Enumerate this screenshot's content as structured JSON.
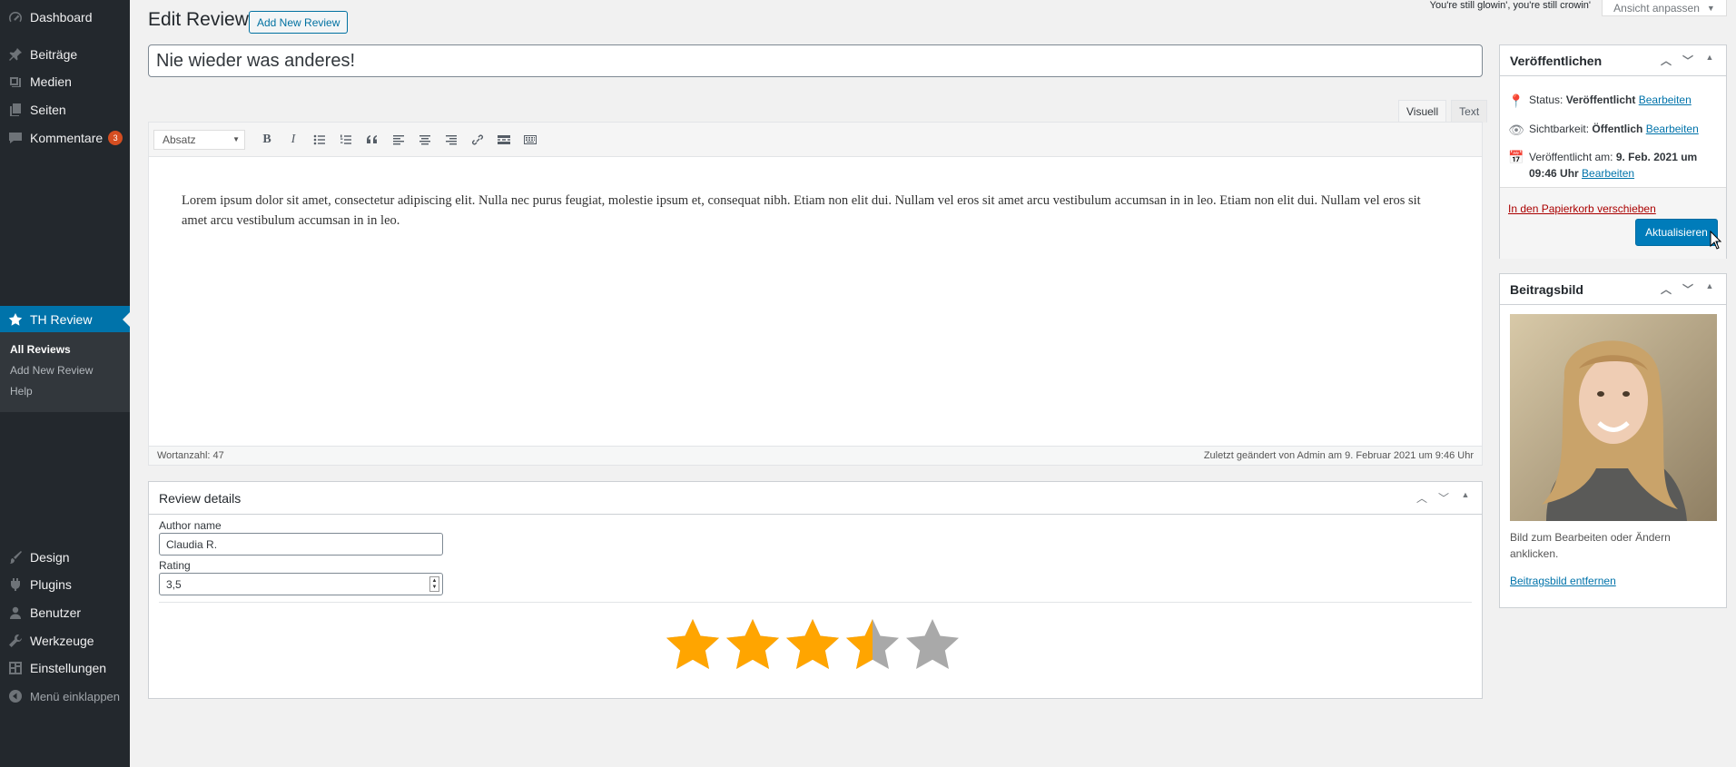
{
  "sidebar": {
    "items": [
      {
        "label": "Dashboard",
        "icon": "dashboard-icon"
      },
      {
        "label": "Beiträge",
        "icon": "pin-icon"
      },
      {
        "label": "Medien",
        "icon": "media-icon"
      },
      {
        "label": "Seiten",
        "icon": "pages-icon"
      },
      {
        "label": "Kommentare",
        "icon": "comments-icon",
        "badge": "3"
      },
      {
        "label": "TH Review",
        "icon": "star-icon"
      },
      {
        "label": "Design",
        "icon": "brush-icon"
      },
      {
        "label": "Plugins",
        "icon": "plugin-icon"
      },
      {
        "label": "Benutzer",
        "icon": "user-icon"
      },
      {
        "label": "Werkzeuge",
        "icon": "wrench-icon"
      },
      {
        "label": "Einstellungen",
        "icon": "settings-icon"
      },
      {
        "label": "Menü einklappen",
        "icon": "collapse-icon"
      }
    ],
    "submenu": [
      "All Reviews",
      "Add New Review",
      "Help"
    ]
  },
  "topbar": {
    "hello": "You're still glowin', you're still crowin'",
    "screen_options": "Ansicht anpassen"
  },
  "header": {
    "title": "Edit Review",
    "add_new": "Add New Review"
  },
  "post": {
    "title": "Nie wieder was anderes!",
    "content": "Lorem ipsum dolor sit amet, consectetur adipiscing elit. Nulla nec purus feugiat, molestie ipsum et, consequat nibh. Etiam non elit dui. Nullam vel eros sit amet arcu vestibulum accumsan in in leo. Etiam non elit dui. Nullam vel eros sit amet arcu vestibulum accumsan in in leo."
  },
  "editor": {
    "tab_visual": "Visuell",
    "tab_text": "Text",
    "format": "Absatz",
    "word_count": "Wortanzahl: 47",
    "last_edited": "Zuletzt geändert von Admin am 9. Februar 2021 um 9:46 Uhr"
  },
  "review_details": {
    "heading": "Review details",
    "author_label": "Author name",
    "author_value": "Claudia R.",
    "rating_label": "Rating",
    "rating_value": "3,5",
    "rating": 3.5,
    "max_rating": 5,
    "colors": {
      "star_filled": "#ffa500",
      "star_empty": "#a9a9a9"
    }
  },
  "publish": {
    "heading": "Veröffentlichen",
    "status_label": "Status:",
    "status_value": "Veröffentlicht",
    "visibility_label": "Sichtbarkeit:",
    "visibility_value": "Öffentlich",
    "published_label": "Veröffentlicht am:",
    "published_value": "9. Feb. 2021 um 09:46 Uhr",
    "edit": "Bearbeiten",
    "trash": "In den Papierkorb verschieben",
    "update": "Aktualisieren"
  },
  "featured_image": {
    "heading": "Beitragsbild",
    "hint": "Bild zum Bearbeiten oder Ändern anklicken.",
    "remove": "Beitragsbild entfernen"
  }
}
